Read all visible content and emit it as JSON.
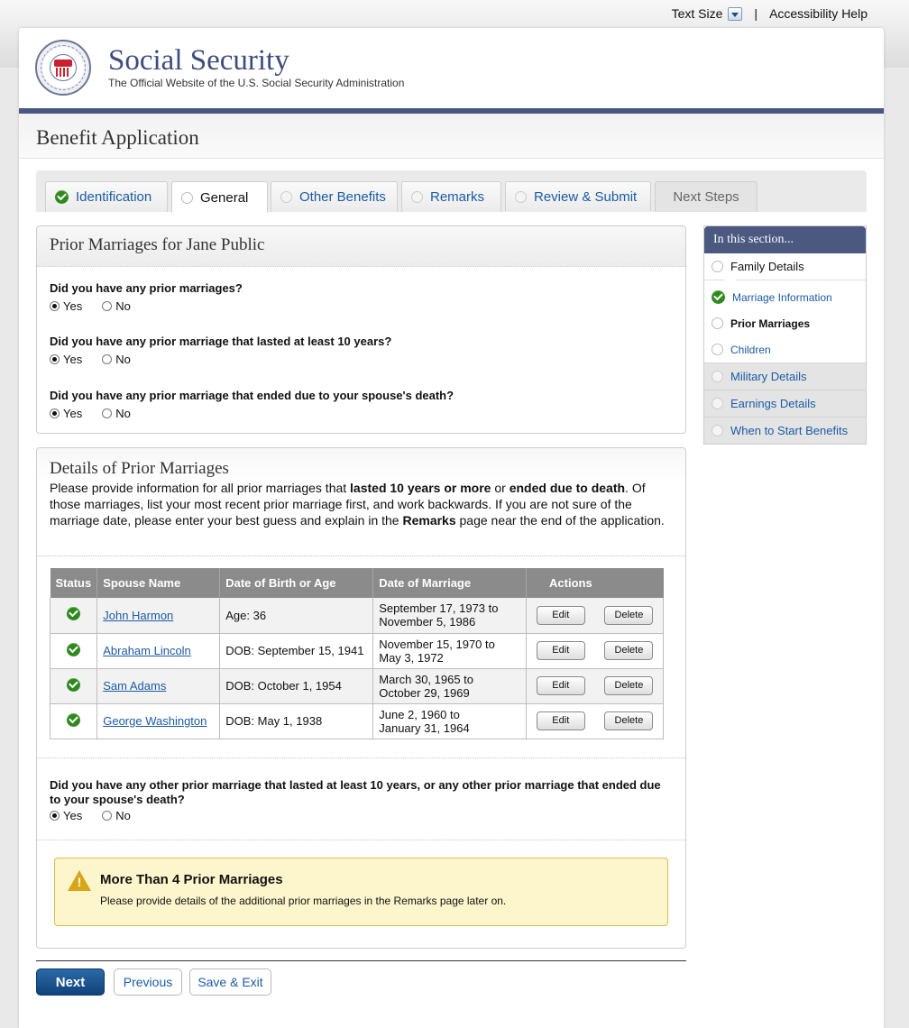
{
  "utility": {
    "text_size": "Text Size",
    "separator": "|",
    "accessibility": "Accessibility Help"
  },
  "brand": {
    "title": "Social Security",
    "subtitle": "The Official Website of the U.S. Social Security Administration",
    "seal_text": "SOCIAL SECURITY USA ADMINISTRATION"
  },
  "page_title": "Benefit Application",
  "tabs": [
    {
      "label": "Identification",
      "state": "complete"
    },
    {
      "label": "General",
      "state": "active"
    },
    {
      "label": "Other Benefits",
      "state": "pending"
    },
    {
      "label": "Remarks",
      "state": "pending"
    },
    {
      "label": "Review & Submit",
      "state": "pending"
    },
    {
      "label": "Next Steps",
      "state": "disabled"
    }
  ],
  "prior_marriages": {
    "title": "Prior Marriages for Jane Public",
    "questions": [
      {
        "text": "Did you have any prior marriages?",
        "selected": "Yes"
      },
      {
        "text": "Did you have any prior marriage that lasted at least 10 years?",
        "selected": "Yes"
      },
      {
        "text": "Did you have any prior marriage that ended due to your spouse's death?",
        "selected": "Yes"
      }
    ],
    "yes_label": "Yes",
    "no_label": "No"
  },
  "details": {
    "title": "Details of Prior Marriages",
    "text_a": "Please provide information for all prior marriages that ",
    "bold_a": "lasted 10 years or more",
    "text_b": " or ",
    "bold_b": "ended due to death",
    "text_c": ". Of those marriages, list your most recent prior marriage first, and work backwards. If you are not sure of the marriage date, please enter your best guess and explain in the ",
    "bold_c": "Remarks",
    "text_d": " page near the end of the application.",
    "columns": [
      "Status",
      "Spouse Name",
      "Date of Birth or Age",
      "Date of Marriage",
      "Actions"
    ],
    "rows": [
      {
        "name": "John Harmon",
        "dob": "Age: 36",
        "m1": "September 17, 1973 to",
        "m2": "November 5, 1986"
      },
      {
        "name": "Abraham Lincoln",
        "dob": "DOB: September 15, 1941",
        "m1": "November 15, 1970 to",
        "m2": "May 3, 1972"
      },
      {
        "name": "Sam Adams",
        "dob": "DOB: October 1, 1954",
        "m1": "March 30, 1965 to",
        "m2": "October 29, 1969"
      },
      {
        "name": "George Washington",
        "dob": "DOB: May 1, 1938",
        "m1": "June 2, 1960 to",
        "m2": "January 31, 1964"
      }
    ],
    "edit_label": "Edit",
    "delete_label": "Delete",
    "other_question": "Did you have any other prior marriage that lasted at least 10 years, or any other prior marriage that ended due to your spouse's death?",
    "other_selected": "Yes",
    "alert_title": "More Than 4 Prior Marriages",
    "alert_text": "Please provide details of the additional prior marriages in the Remarks page later on."
  },
  "buttons": {
    "next": "Next",
    "previous": "Previous",
    "save_exit": "Save & Exit"
  },
  "sidebar": {
    "title": "In this section...",
    "family_details": "Family Details",
    "sub_items": [
      {
        "label": "Marriage Information",
        "state": "complete"
      },
      {
        "label": "Prior Marriages",
        "state": "current"
      },
      {
        "label": "Children",
        "state": "pending"
      }
    ],
    "groups": [
      "Military Details",
      "Earnings Details",
      "When to Start Benefits"
    ]
  },
  "colors": {
    "brand_blue": "#4a5784",
    "link": "#1c5ba5",
    "check_green": "#2f8a1e",
    "alert_bg": "#fdf6cd",
    "next_btn": "#10437a"
  }
}
